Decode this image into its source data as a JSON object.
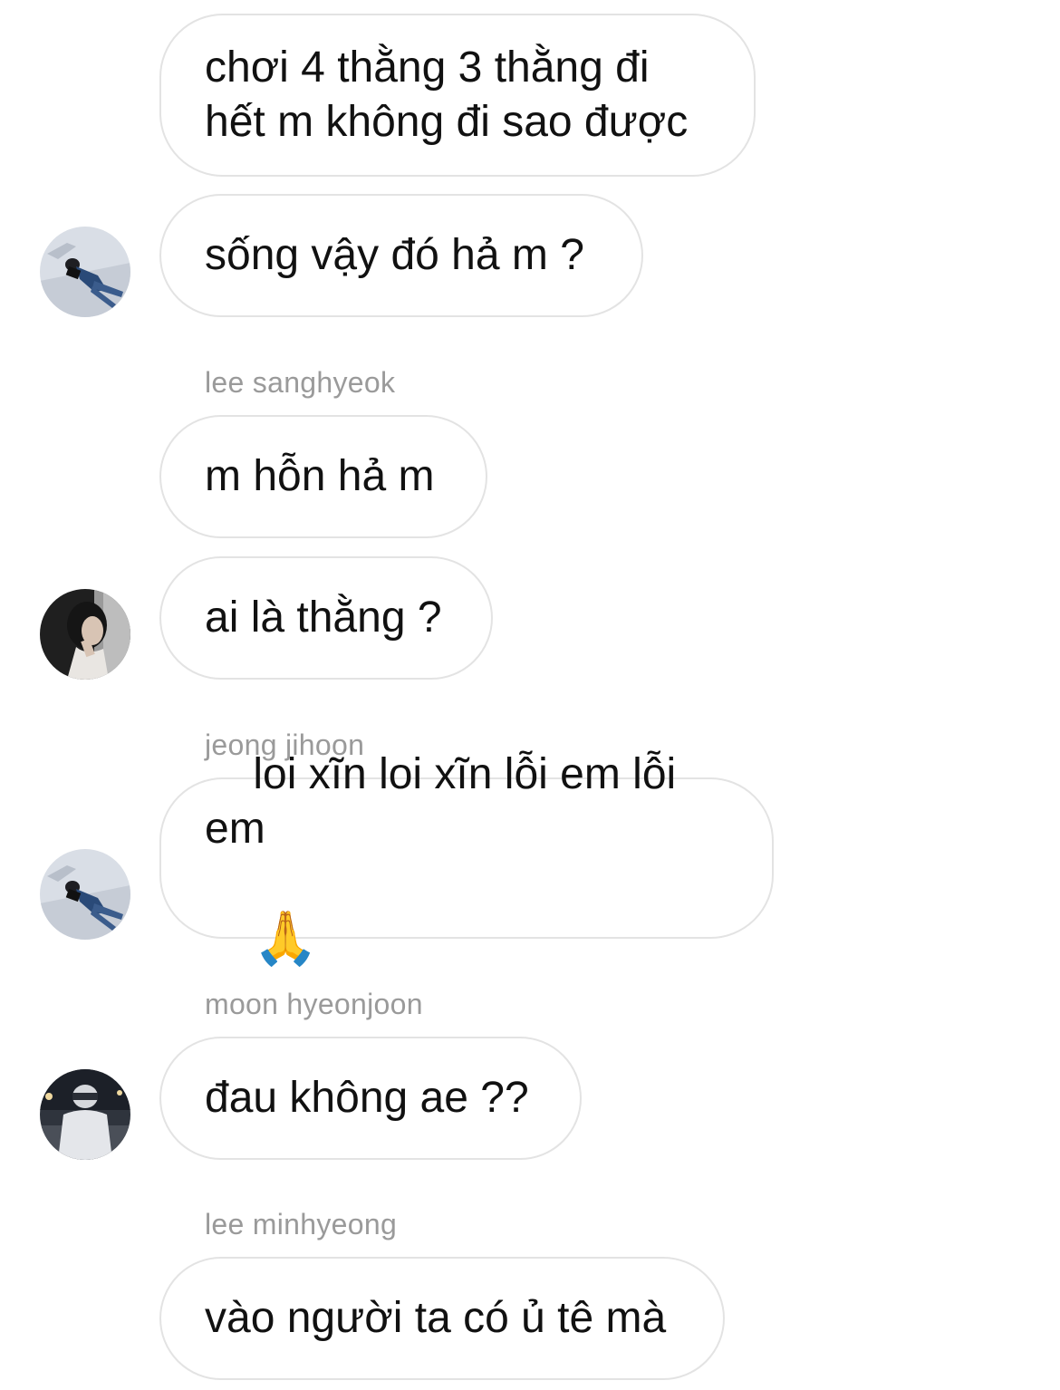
{
  "messages": [
    {
      "text": "chơi 4 thằng 3 thằng đi\nhết m không đi sao được"
    },
    {
      "text": "sống vậy đó hả m ?"
    },
    {
      "sender": "lee sanghyeok",
      "text": "m hỗn hả m"
    },
    {
      "text": "ai là thằng ?"
    },
    {
      "sender": "jeong jihoon",
      "text": "loi xĩn loi xĩn lỗi em lỗi em",
      "emoji": "🙏"
    },
    {
      "sender": "moon hyeonjoon",
      "text": "đau không ae ??"
    },
    {
      "sender": "lee minhyeong",
      "text": "vào người ta có ủ tê mà"
    }
  ],
  "avatars": [
    {
      "icon": "person-lying-on-snow-avatar",
      "accent": "#dfe5ec"
    },
    {
      "icon": "person-portrait-dark-avatar",
      "accent": "#2b2b2b"
    },
    {
      "icon": "person-lying-on-snow-avatar",
      "accent": "#dfe5ec"
    },
    {
      "icon": "person-night-street-avatar",
      "accent": "#3a3f4a"
    }
  ],
  "colors": {
    "bubble_border": "#e3e3e3",
    "sender_text": "#9a9a9a",
    "message_text": "#111111",
    "background": "#ffffff"
  }
}
